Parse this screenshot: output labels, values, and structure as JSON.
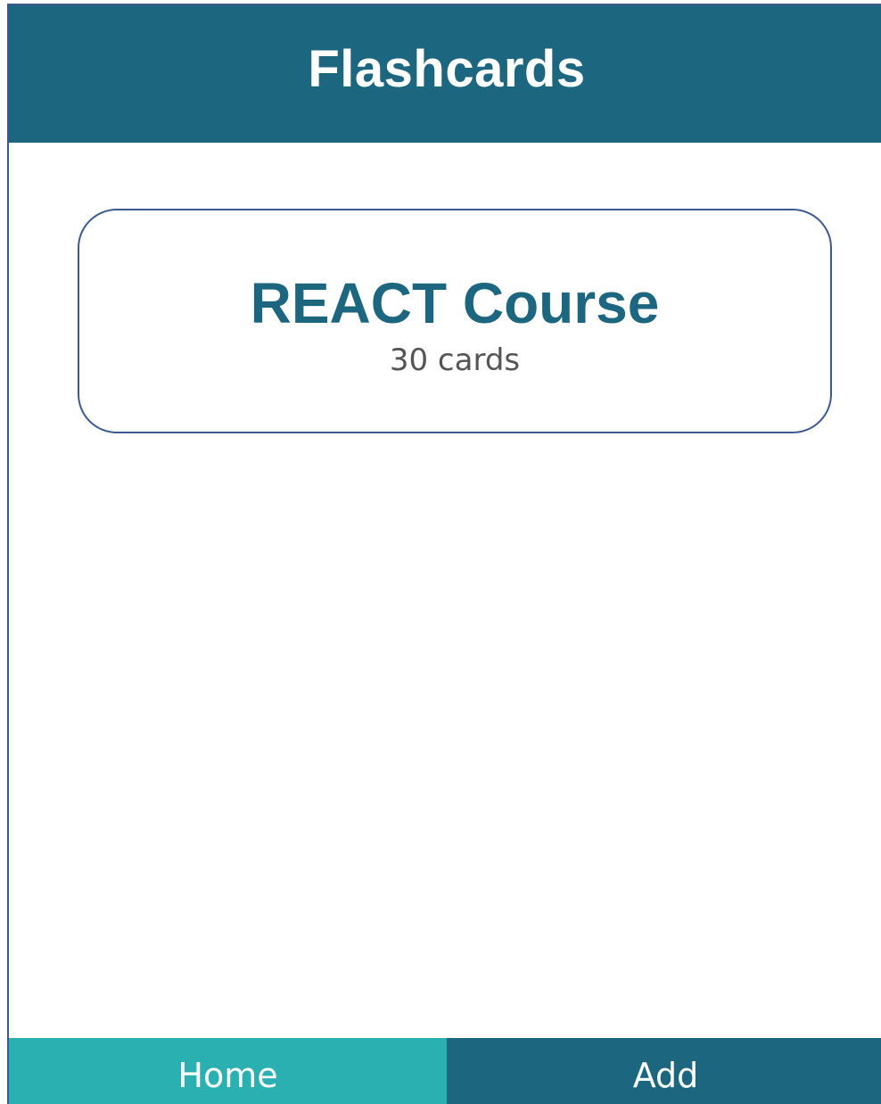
{
  "header": {
    "title": "Flashcards"
  },
  "decks": [
    {
      "title": "REACT Course",
      "count_label": "30 cards"
    }
  ],
  "tabs": [
    {
      "label": "Home",
      "active": true
    },
    {
      "label": "Add",
      "active": false
    }
  ],
  "colors": {
    "primary": "#1c677f",
    "active_tab": "#2ab0b0",
    "border": "#3b5a8f",
    "subtext": "#555555"
  }
}
